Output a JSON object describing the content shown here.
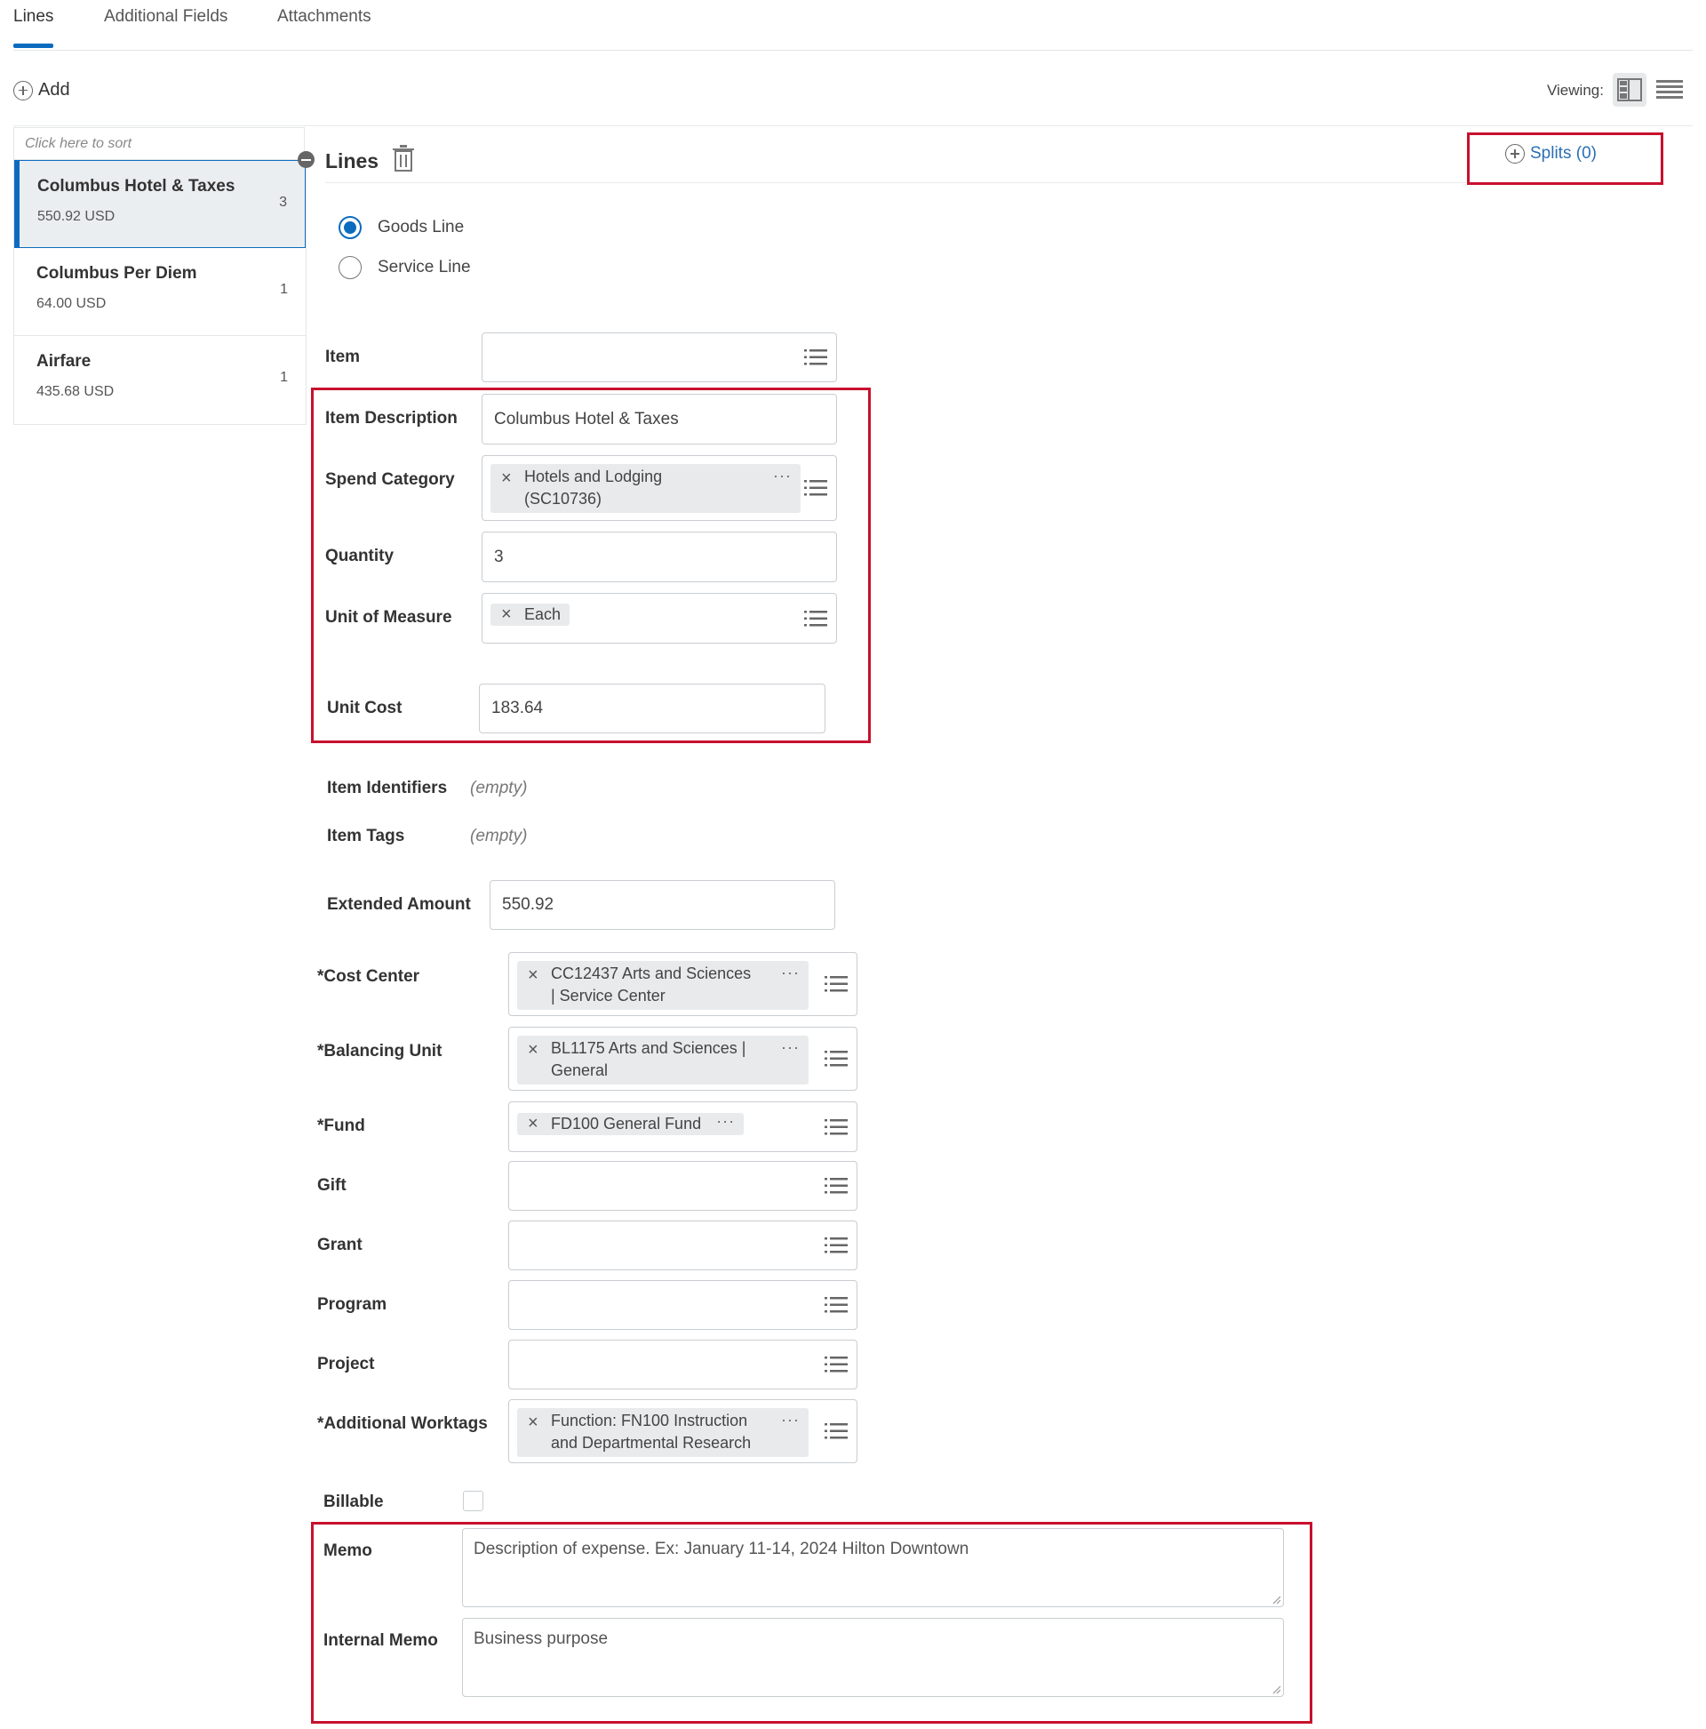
{
  "tabs": [
    {
      "label": "Lines",
      "active": true
    },
    {
      "label": "Additional Fields",
      "active": false
    },
    {
      "label": "Attachments",
      "active": false
    }
  ],
  "toolbar": {
    "add_label": "Add",
    "viewing_label": "Viewing:"
  },
  "list": {
    "sort_hint": "Click here to sort",
    "items": [
      {
        "title": "Columbus Hotel & Taxes",
        "amount": "550.92 USD",
        "count": "3",
        "selected": true
      },
      {
        "title": "Columbus Per Diem",
        "amount": "64.00 USD",
        "count": "1",
        "selected": false
      },
      {
        "title": "Airfare",
        "amount": "435.68 USD",
        "count": "1",
        "selected": false
      }
    ]
  },
  "panel": {
    "title": "Lines",
    "splits_label": "Splits (0)",
    "line_type": {
      "goods": "Goods Line",
      "service": "Service Line",
      "selected": "goods"
    }
  },
  "form": {
    "item": {
      "label": "Item",
      "value": ""
    },
    "item_description": {
      "label": "Item Description",
      "value": "Columbus Hotel & Taxes"
    },
    "spend_category": {
      "label": "Spend Category",
      "line1": "Hotels and Lodging",
      "line2": "(SC10736)"
    },
    "quantity": {
      "label": "Quantity",
      "value": "3"
    },
    "unit_of_measure": {
      "label": "Unit of Measure",
      "value": "Each"
    },
    "unit_cost": {
      "label": "Unit Cost",
      "value": "183.64"
    },
    "item_identifiers": {
      "label": "Item Identifiers",
      "value": "(empty)"
    },
    "item_tags": {
      "label": "Item Tags",
      "value": "(empty)"
    },
    "extended_amount": {
      "label": "Extended Amount",
      "value": "550.92"
    },
    "cost_center": {
      "label": "*Cost Center",
      "line1": "CC12437 Arts and Sciences",
      "line2": "| Service Center"
    },
    "balancing_unit": {
      "label": "*Balancing Unit",
      "line1": "BL1175 Arts and Sciences |",
      "line2": "General"
    },
    "fund": {
      "label": "*Fund",
      "value": "FD100 General Fund"
    },
    "gift": {
      "label": "Gift"
    },
    "grant": {
      "label": "Grant"
    },
    "program": {
      "label": "Program"
    },
    "project": {
      "label": "Project"
    },
    "additional_worktags": {
      "label": "*Additional Worktags",
      "line1": "Function: FN100 Instruction",
      "line2": "and Departmental Research"
    },
    "billable": {
      "label": "Billable",
      "checked": false
    },
    "memo": {
      "label": "Memo",
      "value": "Description of expense.  Ex: January 11-14, 2024 Hilton Downtown"
    },
    "internal_memo": {
      "label": "Internal Memo",
      "value": "Business purpose"
    }
  },
  "colors": {
    "accent": "#0b6bbf",
    "highlight": "#c8102e",
    "link": "#2a6fb3"
  }
}
